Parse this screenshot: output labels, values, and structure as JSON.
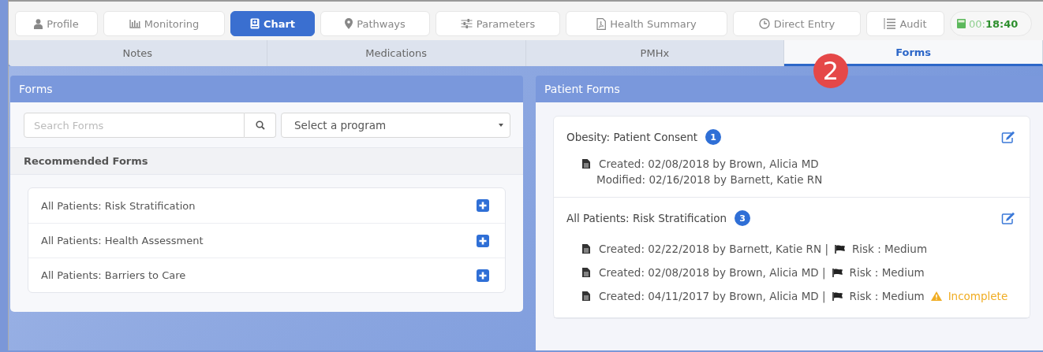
{
  "nav": [
    {
      "label": "Profile",
      "selected": false
    },
    {
      "label": "Monitoring",
      "selected": false
    },
    {
      "label": "Chart",
      "selected": true
    },
    {
      "label": "Pathways",
      "selected": false
    },
    {
      "label": "Parameters",
      "selected": false
    },
    {
      "label": "Health Summary",
      "selected": false
    },
    {
      "label": "Direct Entry",
      "selected": false
    },
    {
      "label": "Audit",
      "selected": false
    }
  ],
  "timer": "00:**18:40**",
  "tabs": [
    {
      "label": "Notes",
      "selected": false
    },
    {
      "label": "Medications",
      "selected": false
    },
    {
      "label": "PMHx",
      "selected": false
    },
    {
      "label": "Forms",
      "selected": true
    }
  ],
  "callout": "2",
  "forms_panel": {
    "title": "Forms",
    "search": {
      "placeholder": "Search Forms"
    },
    "program_select": {
      "value": "Select a program"
    },
    "recommended_title": "Recommended Forms",
    "recommended": [
      "All Patients: Risk Stratification",
      "All Patients: Health Assessment",
      "All Patients: Barriers to Care"
    ]
  },
  "patient_forms": {
    "title": "Patient Forms",
    "forms": [
      {
        "title": "Obesity: Patient Consent",
        "count": "1",
        "entries": [
          {
            "created": "Created: 02/08/2018 by Brown, Alicia MD",
            "modified": "Modified: 02/16/2018 by Barnett, Katie RN"
          }
        ]
      },
      {
        "title": "All Patients: Risk Stratification",
        "count": "3",
        "entries": [
          {
            "created": "Created: 02/22/2018 by Barnett, Katie RN |",
            "risk": "Risk : Medium"
          },
          {
            "created": "Created: 02/08/2018 by Brown, Alicia MD |",
            "risk": "Risk : Medium"
          },
          {
            "created": "Created: 04/11/2017 by Brown, Alicia MD |",
            "risk": "Risk : Medium",
            "status": {
              "kind": "warning",
              "label": "Incomplete"
            }
          }
        ]
      }
    ]
  }
}
